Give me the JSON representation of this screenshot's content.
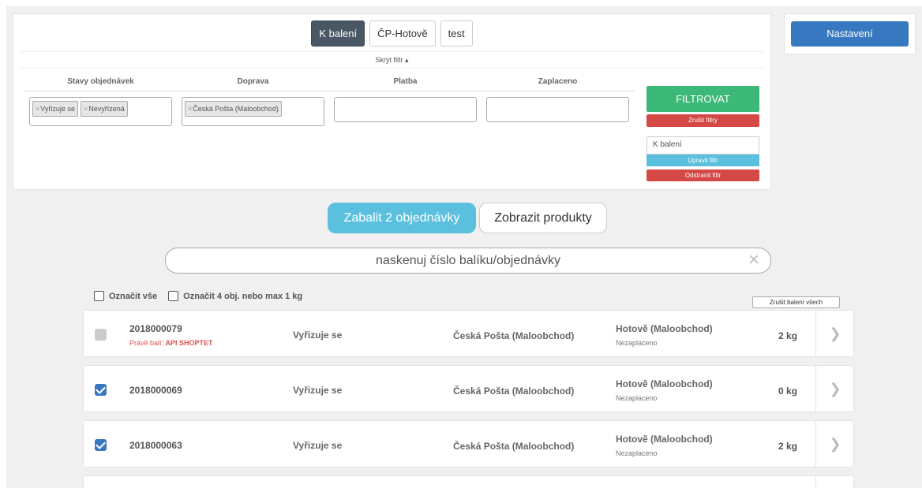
{
  "filter": {
    "tabs": [
      "K balení",
      "ČP-Hotově",
      "test"
    ],
    "active_tab": "K balení",
    "hide_filter": "Skrýt filtr ▴",
    "columns": {
      "order_states": "Stavy objednávek",
      "shipping": "Doprava",
      "payment": "Platba",
      "paid": "Zaplaceno"
    },
    "order_state_chips": [
      "Vyřizuje se",
      "Nevyřízená"
    ],
    "shipping_chips": [
      "Česká Pošta (Maloobchod)"
    ],
    "chip_remove": "×",
    "filtrovat": "FILTROVAT",
    "zrusit_filtry": "Zrušit filtry",
    "filter_name": "K balení",
    "upravit_filtr": "Upravit filtr",
    "odstranit_filtr": "Odstranit filtr"
  },
  "settings": {
    "label": "Nastavení"
  },
  "actions": {
    "pack": "Zabalit 2 objednávky",
    "show_products": "Zobrazit produkty"
  },
  "scan": {
    "placeholder": "naskenuj číslo balíku/objednávky",
    "clear": "×"
  },
  "selection": {
    "select_all": "Označit vše",
    "select_four": "Označit 4 obj. nebo max 1 kg",
    "cancel_all": "Zrušit balení všech objednávek"
  },
  "orders": [
    {
      "id": "2018000079",
      "packing_prefix": "Právě balí:",
      "packing_user": "API SHOPTET",
      "state": "Vyřizuje se",
      "shipping": "Česká Pošta (Maloobchod)",
      "payment": "Hotově (Maloobchod)",
      "paid": "Nezaplaceno",
      "weight": "2 kg",
      "checkbox": "disabled"
    },
    {
      "id": "2018000069",
      "state": "Vyřizuje se",
      "shipping": "Česká Pošta (Maloobchod)",
      "payment": "Hotově (Maloobchod)",
      "paid": "Nezaplaceno",
      "weight": "0 kg",
      "checkbox": "checked"
    },
    {
      "id": "2018000063",
      "state": "Vyřizuje se",
      "shipping": "Česká Pošta (Maloobchod)",
      "payment": "Hotově (Maloobchod)",
      "paid": "Nezaplaceno",
      "weight": "2 kg",
      "checkbox": "checked"
    }
  ],
  "icons": {
    "chevron": "chevron-right-icon",
    "clear": "close-icon"
  },
  "colors": {
    "green": "#3cb878",
    "red": "#d44845",
    "blue": "#3878c0",
    "cyan": "#5bc0de",
    "dark_tab": "#4a5865"
  }
}
